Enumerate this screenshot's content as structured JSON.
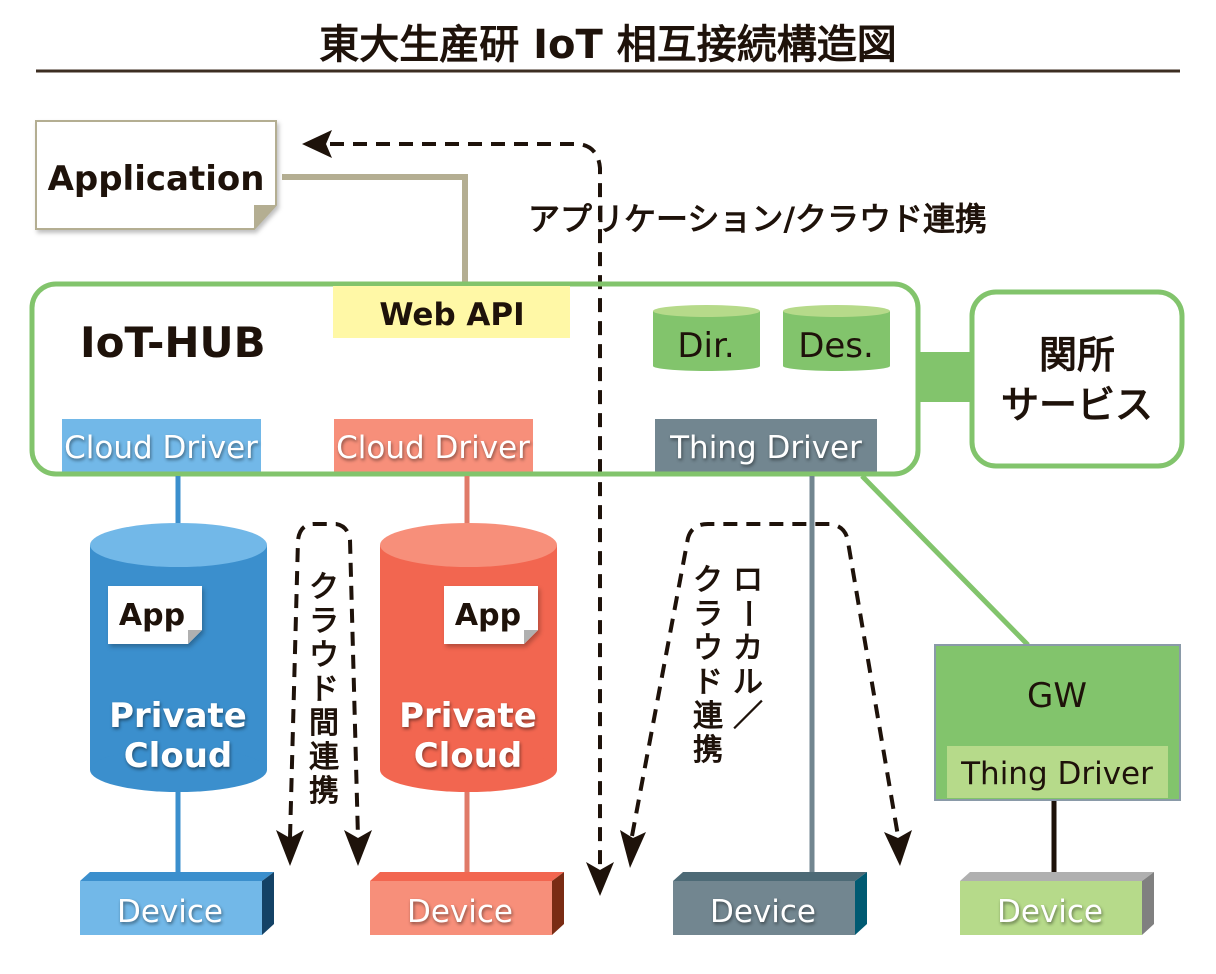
{
  "title": "東大生産研 IoT 相互接続構造図",
  "colors": {
    "hub_border": "#82c46c",
    "cloud_blue": "#3b8fcd",
    "cloud_blue_light": "#72b8e8",
    "cloud_red": "#f26650",
    "cloud_red_light": "#f78f7a",
    "thing_gray": "#728690",
    "webapi_yellow": "#fff8a6",
    "gw_green": "#82c46c",
    "gw_light": "#b6da8a",
    "app_line": "#b4ae92",
    "text_dark": "#1e120a"
  },
  "application": {
    "label": "Application"
  },
  "hub": {
    "label": "IoT-HUB",
    "web_api": "Web API",
    "db_dir": "Dir.",
    "db_des": "Des.",
    "cloud_driver_1": "Cloud Driver",
    "cloud_driver_2": "Cloud Driver",
    "thing_driver": "Thing Driver"
  },
  "sekisho": {
    "line1": "関所",
    "line2": "サービス"
  },
  "labels": {
    "app_cloud_link": "アプリケーション/クラウド連携",
    "inter_cloud_link": [
      "ク",
      "ラ",
      "ウ",
      "ド",
      "間",
      "連",
      "携"
    ],
    "local_link_col1": [
      "ロ",
      "ー",
      "カ",
      "ル",
      "／"
    ],
    "local_link_col2": [
      "ク",
      "ラ",
      "ウ",
      "ド",
      "連",
      "携"
    ]
  },
  "clouds": [
    {
      "app": "App",
      "line1": "Private",
      "line2": "Cloud"
    },
    {
      "app": "App",
      "line1": "Private",
      "line2": "Cloud"
    }
  ],
  "gateway": {
    "label": "GW",
    "driver": "Thing Driver"
  },
  "devices": [
    "Device",
    "Device",
    "Device",
    "Device"
  ]
}
